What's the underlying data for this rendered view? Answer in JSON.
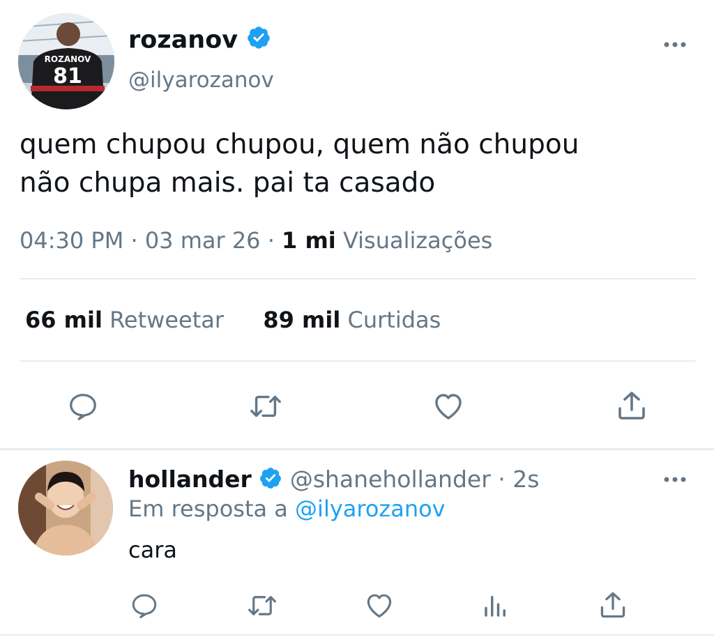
{
  "main_tweet": {
    "display_name": "rozanov",
    "handle": "@ilyarozanov",
    "text_line1": "quem chupou chupou, quem não chupou",
    "text_line2": "não chupa mais. pai ta casado",
    "time": "04:30 PM",
    "date": "03 mar 26",
    "views_count": "1 mi",
    "views_label": "Visualizações",
    "retweets_count": "66 mil",
    "retweets_label": "Retweetar",
    "likes_count": "89 mil",
    "likes_label": "Curtidas",
    "avatar_jersey_name": "ROZANOV",
    "avatar_jersey_number": "81"
  },
  "reply": {
    "display_name": "hollander",
    "handle": "@shanehollander",
    "time_ago": "2s",
    "reply_prefix": "Em resposta a",
    "reply_to": "@ilyarozanov",
    "text": "cara"
  },
  "separator_dot": "·",
  "colors": {
    "verified": "#1da1f2",
    "secondary_text": "#657786",
    "mention": "#1da1f2",
    "divider": "#e6ecf0"
  },
  "icons": {
    "main_actions": [
      "reply-icon",
      "retweet-icon",
      "like-icon",
      "share-icon"
    ],
    "reply_actions": [
      "reply-icon",
      "retweet-icon",
      "like-icon",
      "analytics-icon",
      "share-icon"
    ]
  }
}
